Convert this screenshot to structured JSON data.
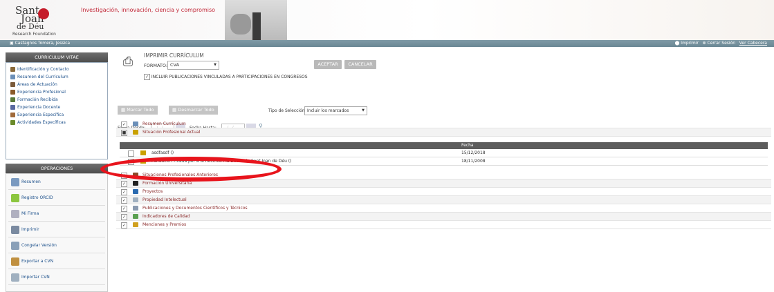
{
  "header": {
    "logo_line1": "Sant",
    "logo_line2": "Joan",
    "logo_line3": "de Déu",
    "logo_sub": "Research Foundation",
    "tagline": "Investigación, innovación, ciencia y compromiso"
  },
  "topbar": {
    "user": "Castagnos Tomera, Jessica",
    "print": "Imprimir",
    "logout": "Cerrar Sesión",
    "version": "Ver Cabecera"
  },
  "sidebar": {
    "cv_title": "CURRICULUM VITAE",
    "items": [
      {
        "label": "Identificación y Contacto",
        "icon": "person-icon",
        "color": "#8a6a3a"
      },
      {
        "label": "Resumen del Currículum",
        "icon": "document-icon",
        "color": "#6b8fb8"
      },
      {
        "label": "Áreas de Actuación",
        "icon": "area-icon",
        "color": "#7a5a3a"
      },
      {
        "label": "Experiencia Profesional",
        "icon": "briefcase-icon",
        "color": "#8a5a2a"
      },
      {
        "label": "Formación Recibida",
        "icon": "formation-icon",
        "color": "#5a7a3a"
      },
      {
        "label": "Experiencia Docente",
        "icon": "teaching-icon",
        "color": "#5a6aa0"
      },
      {
        "label": "Experiencia Específica",
        "icon": "specific-icon",
        "color": "#a06a3a"
      },
      {
        "label": "Actividades Específicas",
        "icon": "activities-icon",
        "color": "#6a8a2a"
      }
    ],
    "ops_title": "OPERACIONES",
    "ops": [
      {
        "label": "Resumen",
        "icon": "summary-icon",
        "color": "#7a9ac0"
      },
      {
        "label": "Registro ORCID",
        "icon": "orcid-icon",
        "color": "#8cc63f"
      },
      {
        "label": "Mi Firma",
        "icon": "signature-icon",
        "color": "#b0b0c0"
      },
      {
        "label": "Imprimir",
        "icon": "printer-icon",
        "color": "#7a8aa0"
      },
      {
        "label": "Congelar Versión",
        "icon": "freeze-icon",
        "color": "#8aa0b8"
      },
      {
        "label": "Exportar a CVN",
        "icon": "export-icon",
        "color": "#c09040"
      },
      {
        "label": "Importar CVN",
        "icon": "import-icon",
        "color": "#a0b0c0"
      }
    ]
  },
  "print_panel": {
    "title": "IMPRIMIR CURRÍCULUM",
    "format_label": "FORMATO:",
    "format_value": "CVA",
    "accept": "ACEPTAR",
    "cancel": "CANCELAR",
    "include_label": "INCLUIR PUBLICACIONES VINCULADAS A PARTICIPACIONES EN CONGRESOS",
    "include_checked": "✓",
    "mark_all": "Marcar Todo",
    "unmark_all": "Desmarcar Todo",
    "selection_type_label": "Tipo de Selección:",
    "selection_type_value": "Incluir los marcados",
    "date_from_label": "Fecha Desde:",
    "date_to_label": "Fecha Hasta:",
    "date_placeholder": "__/__/____"
  },
  "sections": [
    {
      "label": "Resumen Currículum",
      "checked": "✓",
      "color": "#6b8fb8"
    },
    {
      "label": "Situación Profesional Actual",
      "checked": "■",
      "color": "#c9a100"
    }
  ],
  "subtable": {
    "col_date": "Fecha",
    "rows": [
      {
        "label": "asdfasdf ()",
        "date": "15/12/2018",
        "checked": ""
      },
      {
        "label": "Fundació Privada per a la Recerca i la Docència Sant Joan de Déu ()",
        "date": "18/11/2008",
        "checked": "✓"
      }
    ]
  },
  "sections2": [
    {
      "label": "Situaciones Profesionales Anteriores",
      "checked": "✓",
      "color": "#8a4a2a"
    },
    {
      "label": "Formación Universitaria",
      "checked": "✓",
      "color": "#222222"
    },
    {
      "label": "Proyectos",
      "checked": "✓",
      "color": "#2a6ab0"
    },
    {
      "label": "Propiedad Intelectual",
      "checked": "✓",
      "color": "#a0b0c0"
    },
    {
      "label": "Publicaciones y Documentos Científicos y Técnicos",
      "checked": "✓",
      "color": "#8a9ab0"
    },
    {
      "label": "Indicadores de Calidad",
      "checked": "✓",
      "color": "#5aa050"
    },
    {
      "label": "Menciones y Premios",
      "checked": "✓",
      "color": "#d0a020"
    }
  ]
}
